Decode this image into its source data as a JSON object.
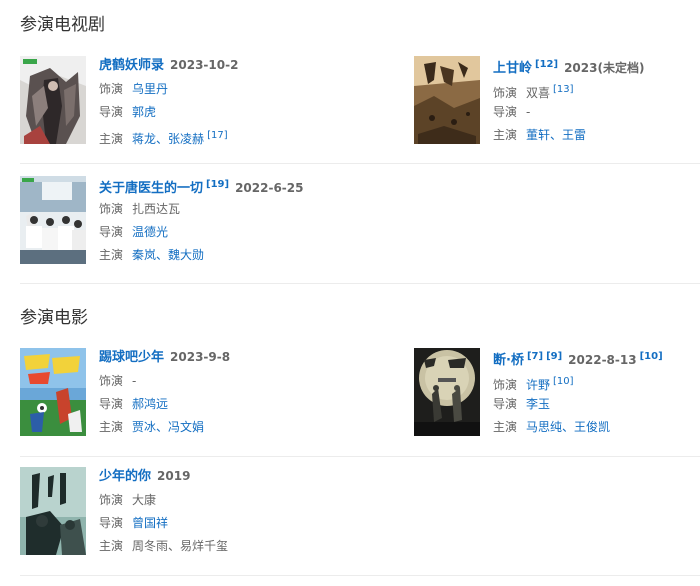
{
  "tv_section": {
    "title": "参演电视剧",
    "items": [
      {
        "title": "虎鹤妖师录",
        "date": "2023-10-2",
        "role_label": "饰演",
        "role": "乌里丹",
        "director_label": "导演",
        "director": "郭虎",
        "cast_label": "主演",
        "cast1": "蒋龙",
        "cast2": "张凌赫",
        "cast_sep": "、",
        "cast_ref": "[17]"
      },
      {
        "title": "上甘岭",
        "title_ref": "[12]",
        "date": "2023(未定档)",
        "role_label": "饰演",
        "role": "双喜",
        "role_ref": "[13]",
        "director_label": "导演",
        "director": "-",
        "cast_label": "主演",
        "cast1": "董轩",
        "cast2": "王雷",
        "cast_sep": "、"
      },
      {
        "title": "关于唐医生的一切",
        "title_ref": "[19]",
        "date": "2022-6-25",
        "role_label": "饰演",
        "role": "扎西达瓦",
        "director_label": "导演",
        "director": "温德光",
        "cast_label": "主演",
        "cast1": "秦岚",
        "cast2": "魏大勋",
        "cast_sep": "、"
      }
    ]
  },
  "film_section": {
    "title": "参演电影",
    "items": [
      {
        "title": "踢球吧少年",
        "date": "2023-9-8",
        "role_label": "饰演",
        "role": "-",
        "director_label": "导演",
        "director": "郝鸿远",
        "cast_label": "主演",
        "cast1": "贾冰",
        "cast2": "冯文娟",
        "cast_sep": "、"
      },
      {
        "title": "断·桥",
        "title_ref": "[7]",
        "title_ref2": "[9]",
        "date": "2022-8-13",
        "date_ref": "[10]",
        "role_label": "饰演",
        "role": "许野",
        "role_ref": "[10]",
        "director_label": "导演",
        "director": "李玉",
        "cast_label": "主演",
        "cast1": "马思纯",
        "cast2": "王俊凯",
        "cast_sep": "、"
      },
      {
        "title": "少年的你",
        "date": "2019",
        "role_label": "饰演",
        "role": "大康",
        "director_label": "导演",
        "director": "曾国祥",
        "cast_label": "主演",
        "cast1": "周冬雨",
        "cast2": "易烊千玺",
        "cast_sep": "、"
      }
    ]
  },
  "posters": {
    "tv_0": "poster-huhe",
    "tv_1": "poster-shangganling",
    "tv_2": "poster-tangyisheng",
    "film_0": "poster-tiqiuba",
    "film_1": "poster-duanqiao",
    "film_2": "poster-shaonian"
  },
  "colors": {
    "link": "#136ec2",
    "label": "#666666",
    "divider": "#ececec"
  }
}
